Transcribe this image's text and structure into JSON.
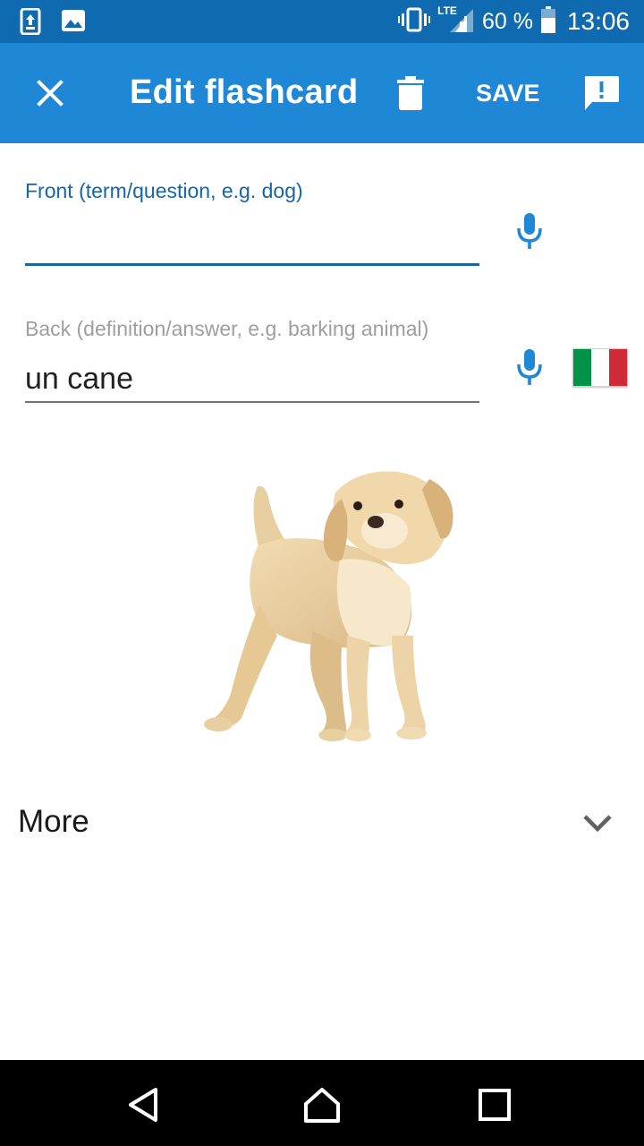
{
  "status_bar": {
    "battery_percent_text": "60 %",
    "time": "13:06",
    "network_label": "LTE",
    "icons": [
      "screenshot-upload-icon",
      "image-icon",
      "vibrate-icon",
      "signal-icon",
      "battery-icon"
    ]
  },
  "app_bar": {
    "title": "Edit flashcard",
    "save_label": "SAVE",
    "icons": [
      "close-icon",
      "delete-icon",
      "report-icon"
    ],
    "color": "#1e88d6"
  },
  "front_field": {
    "label": "Front (term/question, e.g. dog)",
    "value": "",
    "accent_color": "#1565a8"
  },
  "back_field": {
    "label": "Back (definition/answer, e.g. barking animal)",
    "value": "un cane",
    "language_flag": "italian-flag",
    "flag_colors": [
      "#009246",
      "#ffffff",
      "#ce2b37"
    ]
  },
  "image": {
    "subject": "puppy"
  },
  "more_section": {
    "label": "More",
    "icon": "chevron-down-icon"
  },
  "nav_bar": {
    "icons": [
      "back-icon",
      "home-icon",
      "recents-icon"
    ]
  }
}
